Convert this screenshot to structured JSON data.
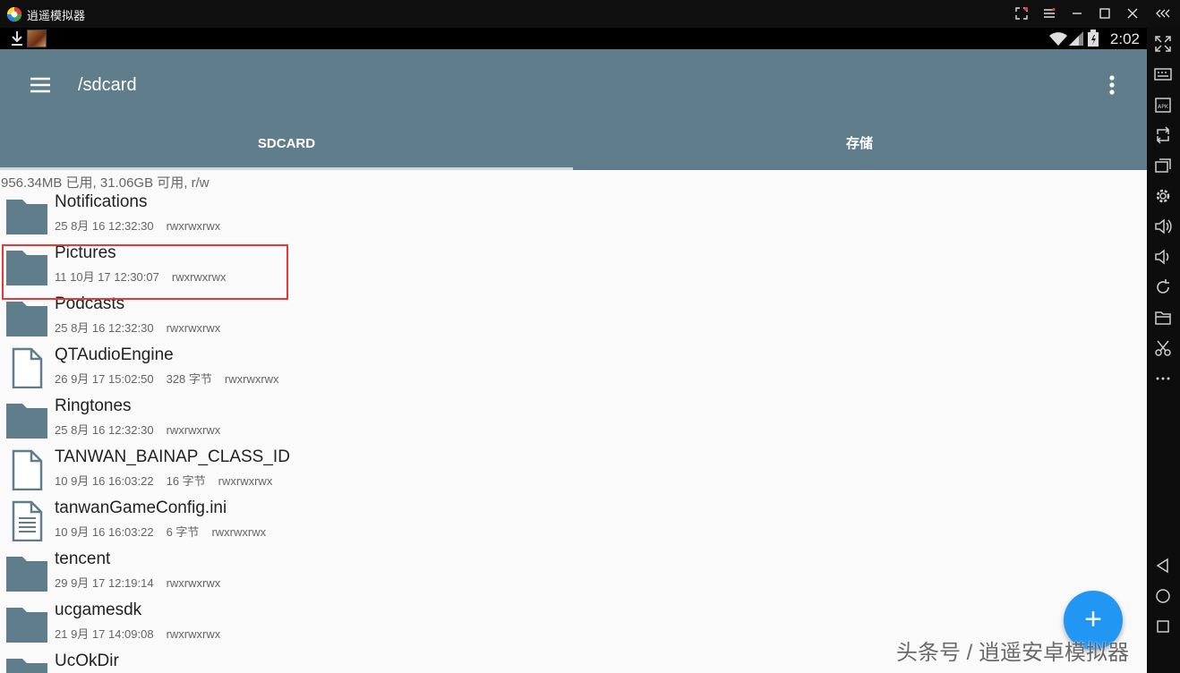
{
  "window": {
    "title": "逍遥模拟器",
    "controls": [
      "expand-icon",
      "menu-icon",
      "minimize-icon",
      "maximize-icon",
      "close-icon",
      "collapse-icon"
    ]
  },
  "status_bar": {
    "time": "2:02"
  },
  "app_bar": {
    "path": "/sdcard",
    "tabs": [
      {
        "label": "SDCARD",
        "active": true
      },
      {
        "label": "存储",
        "active": false
      }
    ]
  },
  "storage_info": "956.34MB 已用, 31.06GB 可用, r/w",
  "files": [
    {
      "name": "Notifications",
      "date": "25 8月 16 12:32:30",
      "size": "",
      "perms": "rwxrwxrwx",
      "type": "folder"
    },
    {
      "name": "Pictures",
      "date": "11 10月 17 12:30:07",
      "size": "",
      "perms": "rwxrwxrwx",
      "type": "folder",
      "highlighted": true
    },
    {
      "name": "Podcasts",
      "date": "25 8月 16 12:32:30",
      "size": "",
      "perms": "rwxrwxrwx",
      "type": "folder"
    },
    {
      "name": "QTAudioEngine",
      "date": "26 9月 17 15:02:50",
      "size": "328 字节",
      "perms": "rwxrwxrwx",
      "type": "file"
    },
    {
      "name": "Ringtones",
      "date": "25 8月 16 12:32:30",
      "size": "",
      "perms": "rwxrwxrwx",
      "type": "folder"
    },
    {
      "name": "TANWAN_BAINAP_CLASS_ID",
      "date": "10 9月 16 16:03:22",
      "size": "16 字节",
      "perms": "rwxrwxrwx",
      "type": "file"
    },
    {
      "name": "tanwanGameConfig.ini",
      "date": "10 9月 16 16:03:22",
      "size": "6 字节",
      "perms": "rwxrwxrwx",
      "type": "text-file"
    },
    {
      "name": "tencent",
      "date": "29 9月 17 12:19:14",
      "size": "",
      "perms": "rwxrwxrwx",
      "type": "folder"
    },
    {
      "name": "ucgamesdk",
      "date": "21 9月 17 14:09:08",
      "size": "",
      "perms": "rwxrwxrwx",
      "type": "folder"
    },
    {
      "name": "UcOkDir",
      "date": "",
      "size": "",
      "perms": "",
      "type": "folder"
    }
  ],
  "fab": {
    "label": "+"
  },
  "watermark": "头条号 / 逍遥安卓模拟器",
  "colors": {
    "app_bar": "#607d8b",
    "folder": "#607d8b",
    "fab": "#2196f3",
    "highlight": "#e53935"
  },
  "sidebar_icons": [
    "fullscreen-icon",
    "keyboard-icon",
    "apk-install-icon",
    "sync-icon",
    "multi-window-icon",
    "settings-icon",
    "volume-up-icon",
    "volume-down-icon",
    "rotate-icon",
    "folder-icon",
    "scissors-icon",
    "more-icon",
    "back-icon",
    "home-icon",
    "recents-icon"
  ]
}
